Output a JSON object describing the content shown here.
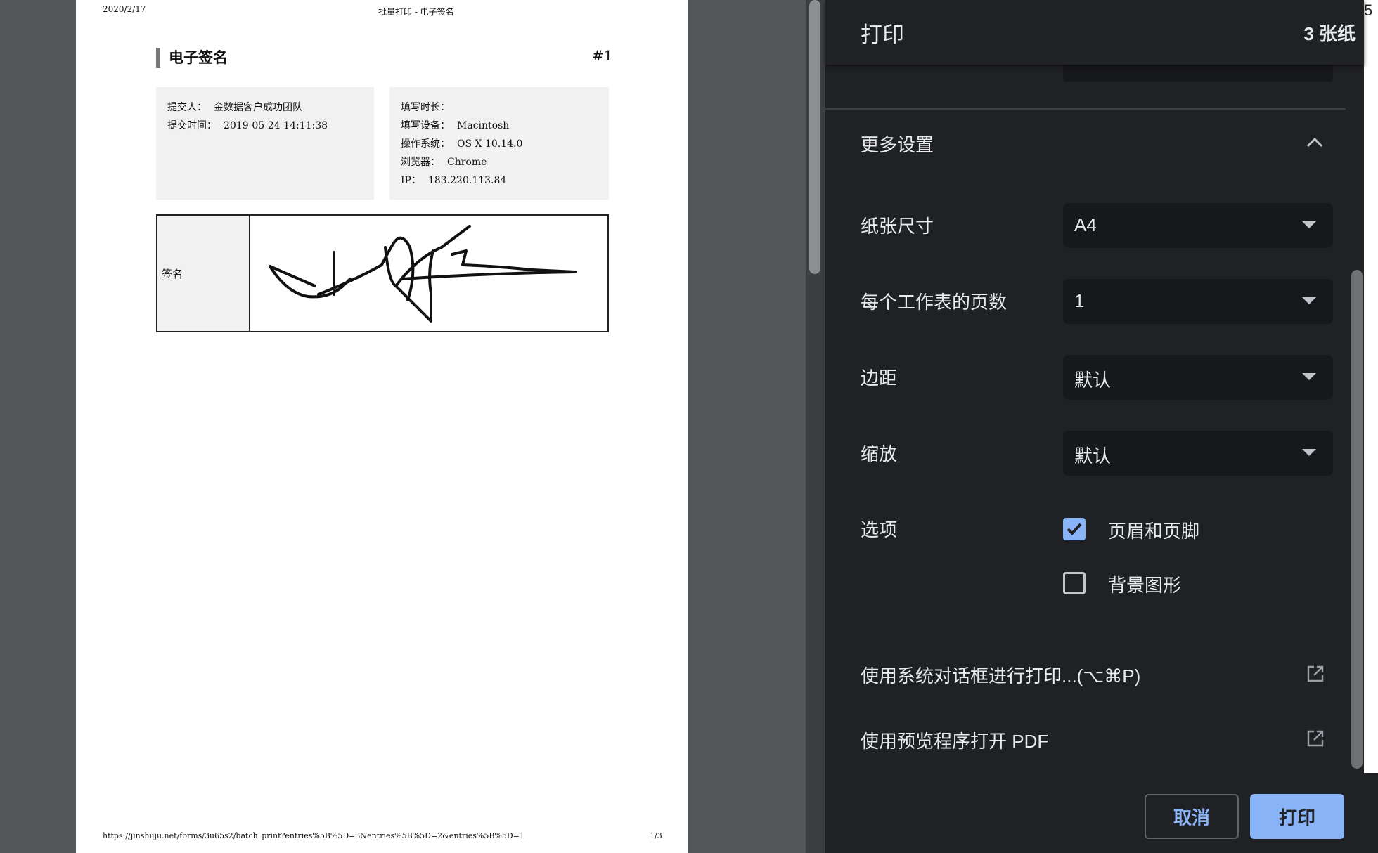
{
  "preview": {
    "date": "2020/2/17",
    "header_title": "批量打印 - 电子签名",
    "section_title": "电子签名",
    "entry_number": "#1",
    "submitter_label": "提交人：",
    "submitter_value": "金数据客户成功团队",
    "submit_time_label": "提交时间：",
    "submit_time_value": "2019-05-24 14:11:38",
    "duration_label": "填写时长：",
    "duration_value": "",
    "device_label": "填写设备：",
    "device_value": "Macintosh",
    "os_label": "操作系统：",
    "os_value": "OS X 10.14.0",
    "browser_label": "浏览器：",
    "browser_value": "Chrome",
    "ip_label": "IP：",
    "ip_value": "183.220.113.84",
    "signature_label": "签名",
    "footer_url": "https://jinshuju.net/forms/3u65s2/batch_print?entries%5B%5D=3&entries%5B%5D=2&entries%5B%5D=1",
    "page_number": "1/3"
  },
  "panel": {
    "title": "打印",
    "sheet_count": "3 张纸",
    "more_settings": "更多设置",
    "paper_size_label": "纸张尺寸",
    "paper_size_value": "A4",
    "pages_per_sheet_label": "每个工作表的页数",
    "pages_per_sheet_value": "1",
    "margins_label": "边距",
    "margins_value": "默认",
    "scale_label": "缩放",
    "scale_value": "默认",
    "options_label": "选项",
    "option_headers_footers": "页眉和页脚",
    "option_headers_footers_checked": true,
    "option_background_graphics": "背景图形",
    "option_background_graphics_checked": false,
    "system_dialog_link": "使用系统对话框进行打印...(⌥⌘P)",
    "open_pdf_link": "使用预览程序打开 PDF",
    "cancel_label": "取消",
    "print_label": "打印"
  },
  "corner_text": "5",
  "colors": {
    "accent": "#8ab4f8",
    "panel_bg": "#202124",
    "select_bg": "#17181b",
    "preview_bg": "#525659"
  }
}
